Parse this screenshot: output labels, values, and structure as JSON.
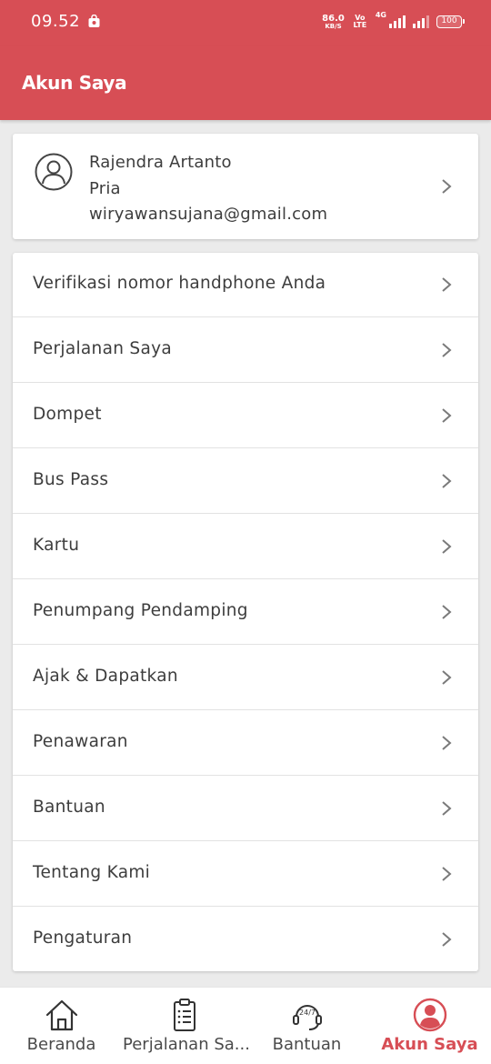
{
  "status_bar": {
    "time": "09.52",
    "speed_value": "86.0",
    "speed_unit": "KB/S",
    "volte": "Vo LTE",
    "network": "4G",
    "battery": "100"
  },
  "header": {
    "title": "Akun Saya"
  },
  "profile": {
    "name": "Rajendra Artanto",
    "gender": "Pria",
    "email": "wiryawansujana@gmail.com"
  },
  "menu": [
    {
      "label": "Verifikasi nomor handphone Anda"
    },
    {
      "label": "Perjalanan Saya"
    },
    {
      "label": "Dompet"
    },
    {
      "label": "Bus Pass"
    },
    {
      "label": "Kartu"
    },
    {
      "label": "Penumpang Pendamping"
    },
    {
      "label": "Ajak & Dapatkan"
    },
    {
      "label": "Penawaran"
    },
    {
      "label": "Bantuan"
    },
    {
      "label": "Tentang Kami"
    },
    {
      "label": "Pengaturan"
    }
  ],
  "bottom_nav": [
    {
      "label": "Beranda",
      "icon": "home-icon",
      "active": false
    },
    {
      "label": "Perjalanan Sa...",
      "icon": "clipboard-icon",
      "active": false
    },
    {
      "label": "Bantuan",
      "icon": "support-24-7-icon",
      "active": false
    },
    {
      "label": "Akun Saya",
      "icon": "account-icon",
      "active": true
    }
  ],
  "colors": {
    "brand": "#d74e55",
    "text": "#3d3d3d",
    "chevron": "#7a7a7a"
  }
}
